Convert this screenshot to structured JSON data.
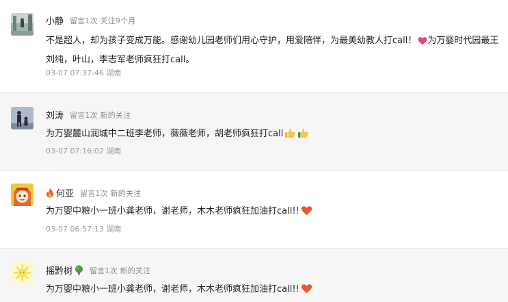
{
  "comments": [
    {
      "name": "小静",
      "meta": "留言1次 关注9个月",
      "text_a": "不是超人，却为孩子变成万能。感谢幼儿园老师们用心守护，用爱陪伴，为最美幼教人打call！",
      "text_b": "为万婴时代园最王刘纯，叶山，李志军老师疯狂打call。",
      "time": "03-07 07:37:46 湖南"
    },
    {
      "name": "刘涛",
      "meta": "留言1次 新的关注",
      "text": "为万婴麓山润城中二班李老师，薇薇老师，胡老师疯狂打call",
      "time": "03-07 07:16:02 湖南"
    },
    {
      "name": "何亚",
      "meta": "留言1次 新的关注",
      "text": "为万婴中粮小一班小龚老师，谢老师，木木老师疯狂加油打call!!",
      "time": "03-07 06:57:13 湖南"
    },
    {
      "name": "摇黔树",
      "meta": "留言1次 新的关注",
      "text": "为万婴中粮小一班小龚老师，谢老师，木木老师疯狂加油打call!!"
    }
  ]
}
